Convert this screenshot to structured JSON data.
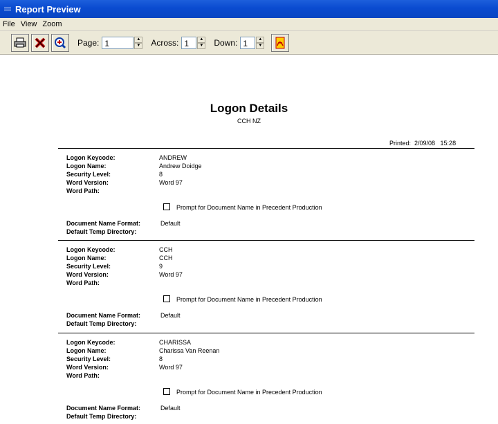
{
  "window": {
    "title": "Report Preview"
  },
  "menu": [
    "File",
    "View",
    "Zoom"
  ],
  "toolbar": {
    "page_label": "Page:",
    "page_value": "1",
    "across_label": "Across:",
    "across_value": "1",
    "down_label": "Down:",
    "down_value": "1",
    "icons": [
      "print-icon",
      "close-icon",
      "zoom-icon",
      "pdf-export-icon"
    ]
  },
  "report": {
    "title": "Logon Details",
    "subtitle": "CCH NZ",
    "printed": "Printed:  2/09/08   15:28",
    "labels": {
      "keycode": "Logon Keycode:",
      "name": "Logon Name:",
      "security": "Security Level:",
      "word_version": "Word Version:",
      "word_path": "Word Path:",
      "doc_format": "Document Name Format:",
      "temp_dir": "Default Temp Directory:"
    },
    "prompt_text": "Prompt for Document Name in Precedent Production",
    "records": [
      {
        "keycode": "ANDREW",
        "name": "Andrew Doidge",
        "security": "8",
        "word_version": "Word 97",
        "doc_format": "Default",
        "prompt_checked": false
      },
      {
        "keycode": "CCH",
        "name": "CCH",
        "security": "9",
        "word_version": "Word 97",
        "doc_format": "Default",
        "prompt_checked": false
      },
      {
        "keycode": "CHARISSA",
        "name": "Charissa Van Reenan",
        "security": "8",
        "word_version": "Word 97",
        "doc_format": "Default",
        "prompt_checked": false
      }
    ]
  }
}
